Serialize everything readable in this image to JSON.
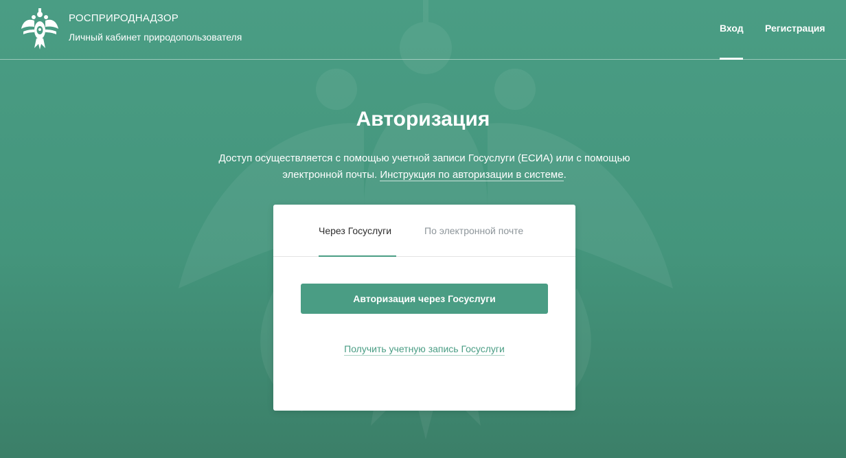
{
  "header": {
    "org_name": "РОСПРИРОДНАДЗОР",
    "subtitle": "Личный кабинет природопользователя",
    "nav": {
      "login": "Вход",
      "register": "Регистрация"
    }
  },
  "auth": {
    "title": "Авторизация",
    "intro_text": "Доступ осуществляется с помощью учетной записи Госуслуги (ЕСИА) или с помощью электронной почты. ",
    "intro_link": "Инструкция по авторизации в системе",
    "intro_end": ".",
    "tabs": {
      "gosuslugi": "Через Госуслуги",
      "email": "По электронной почте"
    },
    "button_label": "Авторизация через Госуслуги",
    "get_account_link": "Получить учетную запись Госуслуги"
  },
  "colors": {
    "accent": "#4a9d84",
    "background": "#44957c",
    "inactive_tab": "#8d959a"
  },
  "icons": {
    "logo": "double-headed-eagle-emblem",
    "watermark": "double-headed-eagle-watermark"
  }
}
